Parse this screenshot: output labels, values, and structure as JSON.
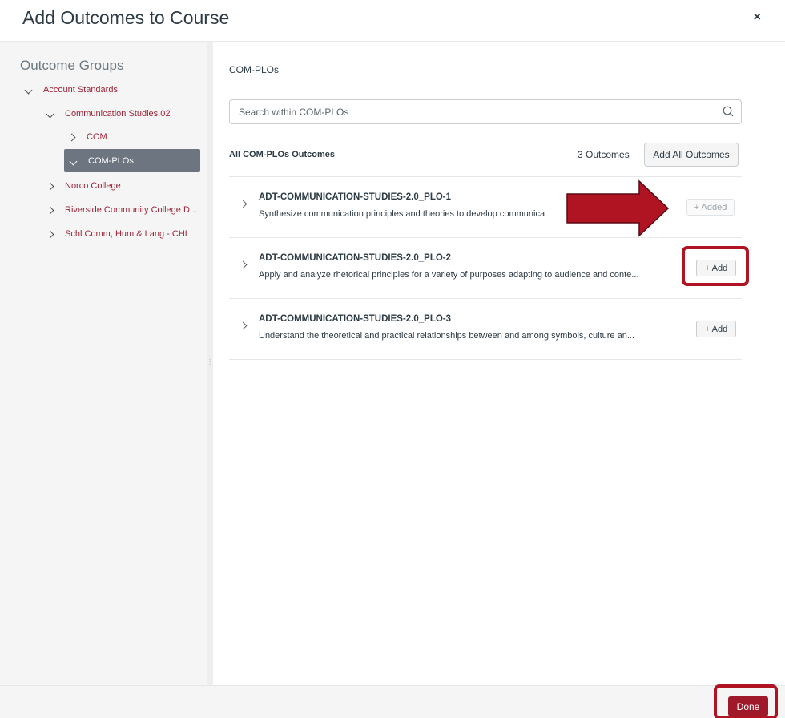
{
  "modal": {
    "title": "Add Outcomes to Course",
    "close_symbol": "×"
  },
  "sidebar": {
    "title": "Outcome Groups",
    "tree": [
      {
        "label": "Account Standards",
        "expanded": true,
        "level": 0
      },
      {
        "label": "Communication Studies.02",
        "expanded": true,
        "level": 1
      },
      {
        "label": "COM",
        "expanded": false,
        "level": 2
      },
      {
        "label": "COM-PLOs",
        "expanded": true,
        "level": 2,
        "selected": true
      },
      {
        "label": "Norco College",
        "expanded": false,
        "level": 1
      },
      {
        "label": "Riverside Community College D...",
        "expanded": false,
        "level": 1
      },
      {
        "label": "Schl Comm, Hum & Lang - CHL",
        "expanded": false,
        "level": 1
      }
    ]
  },
  "main": {
    "group_name": "COM-PLOs",
    "search": {
      "placeholder": "Search within COM-PLOs",
      "value": ""
    },
    "list_heading": "All COM-PLOs Outcomes",
    "outcome_count": "3 Outcomes",
    "add_all_label": "Add All Outcomes",
    "outcomes": [
      {
        "title": "ADT-COMMUNICATION-STUDIES-2.0_PLO-1",
        "description": "Synthesize communication principles and theories to develop communica",
        "button": "+ Added",
        "added": true
      },
      {
        "title": "ADT-COMMUNICATION-STUDIES-2.0_PLO-2",
        "description": "Apply and analyze rhetorical principles for a variety of purposes adapting to audience and conte...",
        "button": "+ Add",
        "added": false
      },
      {
        "title": "ADT-COMMUNICATION-STUDIES-2.0_PLO-3",
        "description": "Understand the theoretical and practical relationships between and among symbols, culture an...",
        "button": "+ Add",
        "added": false
      }
    ]
  },
  "footer": {
    "done_label": "Done"
  },
  "colors": {
    "brand": "#9d2235",
    "done_button": "#a0192b",
    "annotation": "#b01322",
    "selected_bg": "#6d7680"
  },
  "icons": {
    "search": "search-icon",
    "close": "close-icon",
    "expand": "chevron-right-icon",
    "collapse": "chevron-down-icon"
  }
}
